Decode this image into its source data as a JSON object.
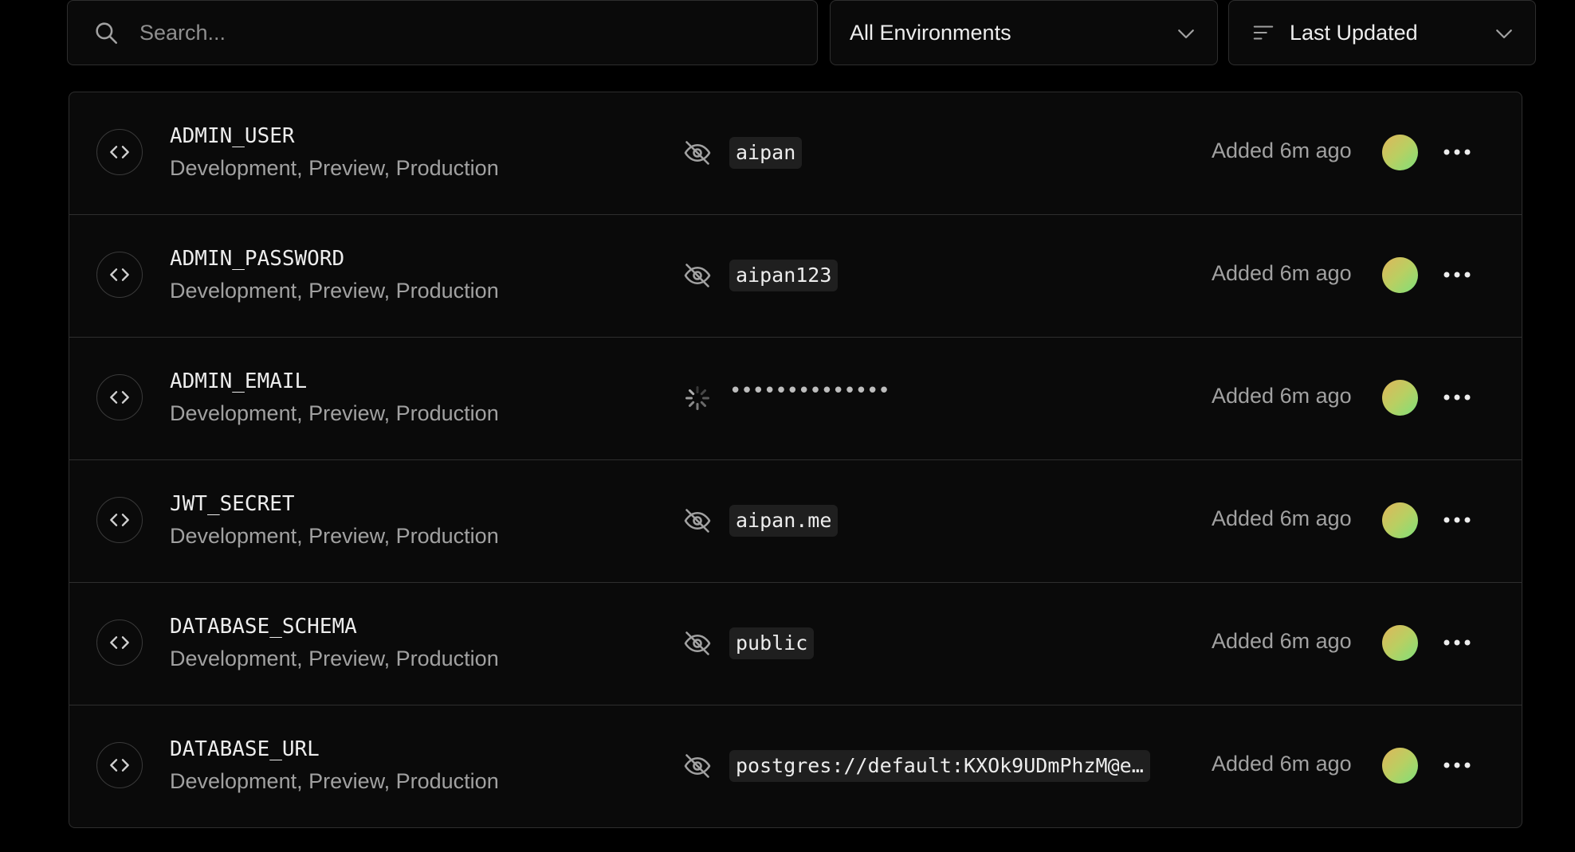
{
  "search": {
    "placeholder": "Search..."
  },
  "filters": {
    "environment": "All Environments",
    "sort": "Last Updated"
  },
  "variables": [
    {
      "name": "ADMIN_USER",
      "environments": "Development, Preview, Production",
      "value": "aipan",
      "loading": false,
      "added": "Added 6m ago"
    },
    {
      "name": "ADMIN_PASSWORD",
      "environments": "Development, Preview, Production",
      "value": "aipan123",
      "loading": false,
      "added": "Added 6m ago"
    },
    {
      "name": "ADMIN_EMAIL",
      "environments": "Development, Preview, Production",
      "value": "••••••••••••••",
      "loading": true,
      "added": "Added 6m ago"
    },
    {
      "name": "JWT_SECRET",
      "environments": "Development, Preview, Production",
      "value": "aipan.me",
      "loading": false,
      "added": "Added 6m ago"
    },
    {
      "name": "DATABASE_SCHEMA",
      "environments": "Development, Preview, Production",
      "value": "public",
      "loading": false,
      "added": "Added 6m ago"
    },
    {
      "name": "DATABASE_URL",
      "environments": "Development, Preview, Production",
      "value": "postgres://default:KXOk9UDmPhzM@e…",
      "loading": false,
      "added": "Added 6m ago"
    }
  ],
  "colors": {
    "background": "#000000",
    "surface": "#0a0a0a",
    "border": "#2e2e2e",
    "muted_text": "#a1a1a1",
    "avatar_gradient": [
      "#e1b65a",
      "#7fe07a"
    ]
  }
}
